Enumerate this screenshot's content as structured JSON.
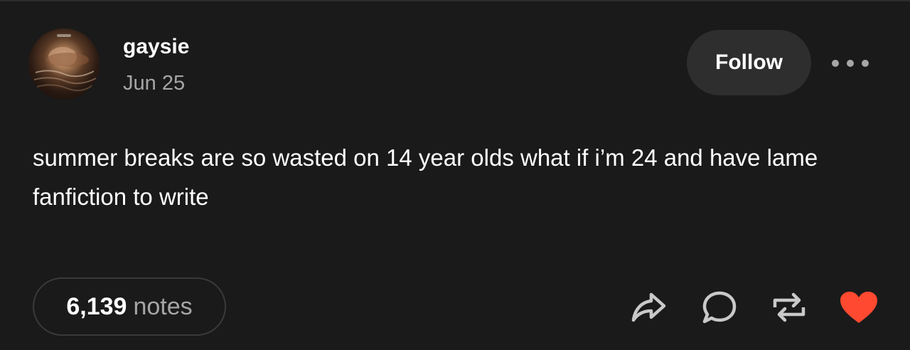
{
  "post": {
    "author": "gaysie",
    "date": "Jun 25",
    "follow_label": "Follow",
    "body": "summer breaks are so wasted on 14 year olds what if i’m 24 and have lame fanfiction to write",
    "notes_count": "6,139",
    "notes_label": "notes"
  },
  "actions": {
    "share_icon": "share-icon",
    "reply_icon": "reply-icon",
    "reblog_icon": "reblog-icon",
    "like_icon": "heart-icon"
  },
  "colors": {
    "background": "#1a1a1a",
    "button_bg": "#2e2e2e",
    "muted_text": "#a6a6a6",
    "icon_gray": "#c9c9c9",
    "like_red": "#ff4930"
  }
}
